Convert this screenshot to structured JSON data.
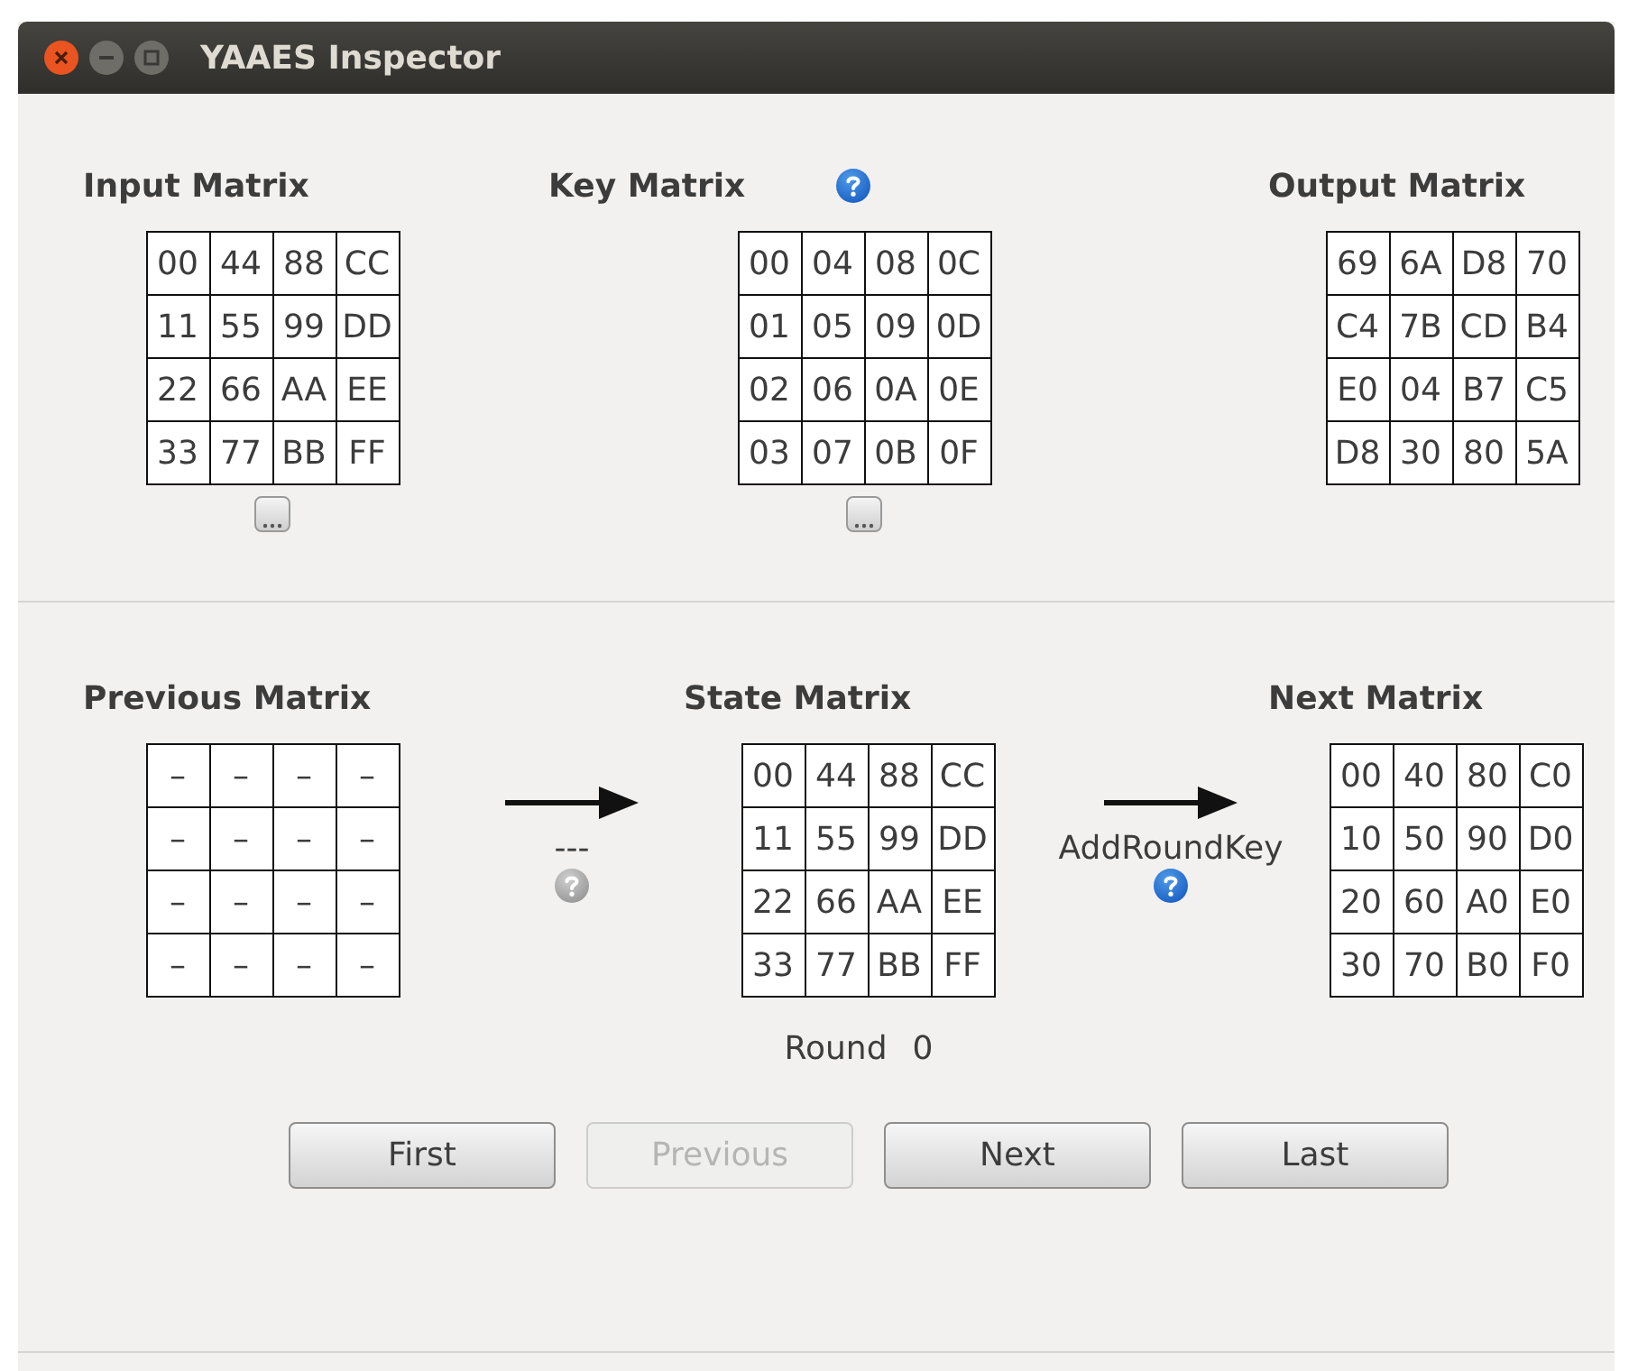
{
  "window": {
    "title": "YAAES Inspector"
  },
  "top": [
    {
      "title": "Input Matrix",
      "kind": "editable",
      "cells": [
        [
          "00",
          "44",
          "88",
          "CC"
        ],
        [
          "11",
          "55",
          "99",
          "DD"
        ],
        [
          "22",
          "66",
          "AA",
          "EE"
        ],
        [
          "33",
          "77",
          "BB",
          "FF"
        ]
      ]
    },
    {
      "title": "Key Matrix",
      "kind": "editable",
      "help": {
        "disabled": false
      },
      "cells": [
        [
          "00",
          "04",
          "08",
          "0C"
        ],
        [
          "01",
          "05",
          "09",
          "0D"
        ],
        [
          "02",
          "06",
          "0A",
          "0E"
        ],
        [
          "03",
          "07",
          "0B",
          "0F"
        ]
      ]
    },
    {
      "title": "Output Matrix",
      "kind": "readonly",
      "cells": [
        [
          "69",
          "6A",
          "D8",
          "70"
        ],
        [
          "C4",
          "7B",
          "CD",
          "B4"
        ],
        [
          "E0",
          "04",
          "B7",
          "C5"
        ],
        [
          "D8",
          "30",
          "80",
          "5A"
        ]
      ]
    }
  ],
  "bottom": [
    {
      "kind": "matrix",
      "title": "Previous Matrix",
      "cells": [
        [
          "–",
          "–",
          "–",
          "–"
        ],
        [
          "–",
          "–",
          "–",
          "–"
        ],
        [
          "–",
          "–",
          "–",
          "–"
        ],
        [
          "–",
          "–",
          "–",
          "–"
        ]
      ]
    },
    {
      "kind": "step",
      "label": "---",
      "help": {
        "disabled": true
      }
    },
    {
      "kind": "matrix",
      "title": "State Matrix",
      "cells": [
        [
          "00",
          "44",
          "88",
          "CC"
        ],
        [
          "11",
          "55",
          "99",
          "DD"
        ],
        [
          "22",
          "66",
          "AA",
          "EE"
        ],
        [
          "33",
          "77",
          "BB",
          "FF"
        ]
      ]
    },
    {
      "kind": "step",
      "label": "AddRoundKey",
      "help": {
        "disabled": false
      }
    },
    {
      "kind": "matrix",
      "title": "Next Matrix",
      "cells": [
        [
          "00",
          "40",
          "80",
          "C0"
        ],
        [
          "10",
          "50",
          "90",
          "D0"
        ],
        [
          "20",
          "60",
          "A0",
          "E0"
        ],
        [
          "30",
          "70",
          "B0",
          "F0"
        ]
      ]
    }
  ],
  "round": {
    "label": "Round",
    "value": "0"
  },
  "buttons": [
    {
      "label": "First",
      "disabled": false
    },
    {
      "label": "Previous",
      "disabled": true
    },
    {
      "label": "Next",
      "disabled": false
    },
    {
      "label": "Last",
      "disabled": false
    }
  ]
}
